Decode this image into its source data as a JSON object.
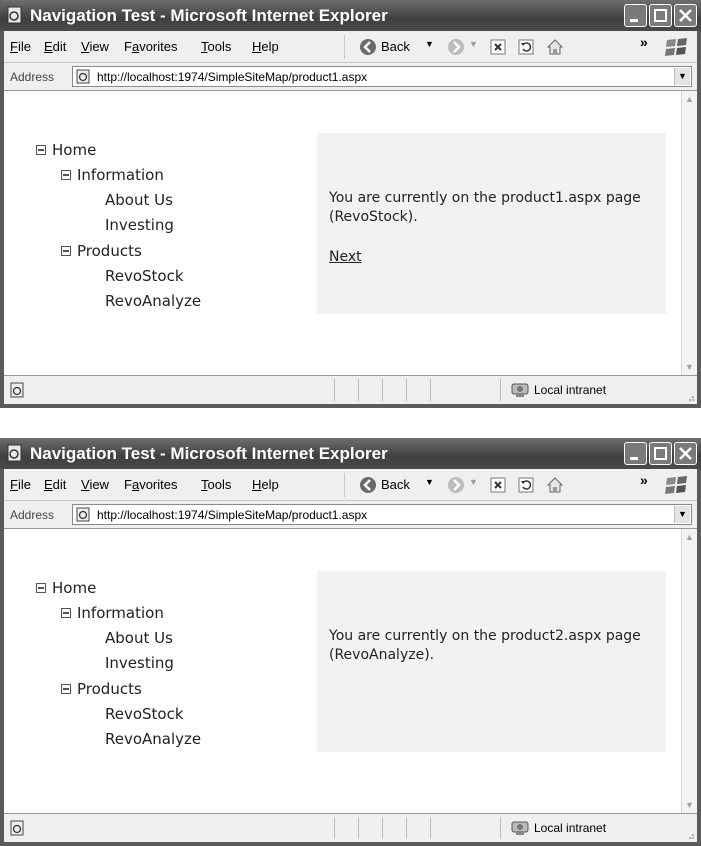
{
  "windows": [
    {
      "title": "Navigation Test - Microsoft Internet Explorer",
      "menu": [
        "File",
        "Edit",
        "View",
        "Favorites",
        "Tools",
        "Help"
      ],
      "menu_underlines": [
        "F",
        "E",
        "V",
        "a",
        "T",
        "H"
      ],
      "toolbar": {
        "back_label": "Back",
        "chevron": "»"
      },
      "address": {
        "label": "Address",
        "url": "http://localhost:1974/SimpleSiteMap/product1.aspx"
      },
      "tree": [
        "Home",
        "Information",
        "About Us",
        "Investing",
        "Products",
        "RevoStock",
        "RevoAnalyze"
      ],
      "panel": {
        "message": "You are currently on the product1.aspx page (RevoStock).",
        "link": "Next"
      },
      "status": {
        "zone": "Local intranet"
      }
    },
    {
      "title": "Navigation Test - Microsoft Internet Explorer",
      "menu": [
        "File",
        "Edit",
        "View",
        "Favorites",
        "Tools",
        "Help"
      ],
      "menu_underlines": [
        "F",
        "E",
        "V",
        "a",
        "T",
        "H"
      ],
      "toolbar": {
        "back_label": "Back",
        "chevron": "»"
      },
      "address": {
        "label": "Address",
        "url": "http://localhost:1974/SimpleSiteMap/product1.aspx"
      },
      "tree": [
        "Home",
        "Information",
        "About Us",
        "Investing",
        "Products",
        "RevoStock",
        "RevoAnalyze"
      ],
      "panel": {
        "message": "You are currently on the product2.aspx page (RevoAnalyze).",
        "link": ""
      },
      "status": {
        "zone": "Local intranet"
      }
    }
  ],
  "icons": {
    "title": "ie-page-icon",
    "minimize": "minimize-icon",
    "maximize": "maximize-icon",
    "close": "close-icon",
    "back": "back-arrow-icon",
    "forward": "forward-arrow-icon",
    "stop": "stop-icon",
    "refresh": "refresh-icon",
    "home": "home-icon",
    "logo": "windows-logo-icon",
    "address": "ie-page-icon",
    "status": "ie-page-icon",
    "zone": "local-intranet-icon"
  }
}
